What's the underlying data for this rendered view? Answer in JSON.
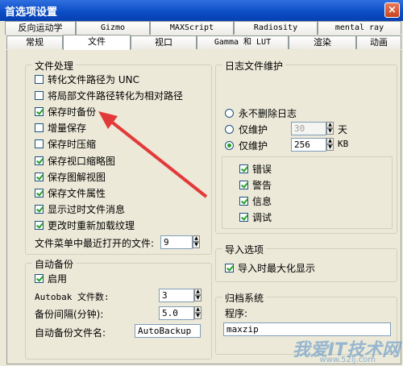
{
  "window": {
    "title": "首选项设置",
    "close": "×"
  },
  "tabs_row1": [
    "反向运动学",
    "Gizmo",
    "MAXScript",
    "Radiosity",
    "mental ray"
  ],
  "tabs_row2": [
    "常规",
    "文件",
    "视口",
    "Gamma 和 LUT",
    "渲染",
    "动画"
  ],
  "file_handling": {
    "title": "文件处理",
    "items": [
      {
        "label": "转化文件路径为 UNC",
        "checked": false
      },
      {
        "label": "将局部文件路径转化为相对路径",
        "checked": false
      },
      {
        "label": "保存时备份",
        "checked": true
      },
      {
        "label": "增量保存",
        "checked": false
      },
      {
        "label": "保存时压缩",
        "checked": false
      },
      {
        "label": "保存视口缩略图",
        "checked": true
      },
      {
        "label": "保存图解视图",
        "checked": true
      },
      {
        "label": "保存文件属性",
        "checked": true
      },
      {
        "label": "显示过时文件消息",
        "checked": true
      },
      {
        "label": "更改时重新加载纹理",
        "checked": true
      }
    ],
    "recent_label": "文件菜单中最近打开的文件:",
    "recent_value": "9"
  },
  "autobackup": {
    "title": "自动备份",
    "enable_label": "启用",
    "enable_checked": true,
    "count_label": "Autobak 文件数:",
    "count_value": "3",
    "interval_label": "备份间隔(分钟):",
    "interval_value": "5.0",
    "name_label": "自动备份文件名:",
    "name_value": "AutoBackup"
  },
  "log": {
    "title": "日志文件维护",
    "never_label": "永不删除日志",
    "days_label": "仅维护",
    "days_value": "30",
    "days_unit": "天",
    "kb_label": "仅维护",
    "kb_value": "256",
    "kb_unit": "KB",
    "selected": "kb",
    "levels": [
      {
        "label": "错误",
        "checked": true
      },
      {
        "label": "警告",
        "checked": true
      },
      {
        "label": "信息",
        "checked": true
      },
      {
        "label": "调试",
        "checked": true
      }
    ]
  },
  "import": {
    "title": "导入选项",
    "maximize_label": "导入时最大化显示",
    "maximize_checked": true
  },
  "archive": {
    "title": "归档系统",
    "program_label": "程序:",
    "program_value": "maxzip"
  },
  "watermark": {
    "text": "我爱IT技术网",
    "url": "www.52ij.com"
  },
  "colors": {
    "accent": "#e23a3a",
    "titlebar": "#0a4cc4"
  }
}
